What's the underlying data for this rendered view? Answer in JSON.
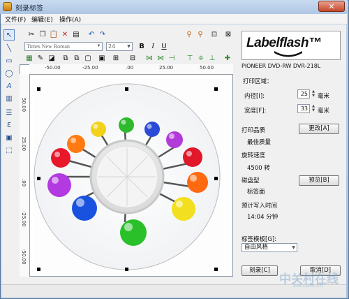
{
  "window": {
    "title": "刻录标签",
    "close_glyph": "✕"
  },
  "menu": {
    "file": "文件(F)",
    "edit": "编辑(E)",
    "operate": "操作(A)"
  },
  "toolbar": {
    "font_name": "Times New Roman",
    "font_size": "24",
    "bold": "B",
    "italic": "I",
    "underline": "U"
  },
  "ruler": {
    "h_ticks": [
      "-50.00",
      "-25.00",
      ".00",
      "25.00",
      "50.00"
    ],
    "v_ticks": [
      "50.00",
      "25.00",
      ".00",
      "-25.00",
      "-50.00"
    ]
  },
  "panel": {
    "logo_text": "Labelflash™",
    "drive_name": "PIONEER DVD-RW  DVR-218L",
    "print_area": "打印区域：",
    "inner_diameter_label": "内径[I]:",
    "inner_diameter_value": "25",
    "inner_unit": "毫米",
    "width_label": "宽度[F]:",
    "width_value": "33",
    "width_unit": "毫米",
    "print_quality_label": "打印品质",
    "change_button": "更改[A]",
    "quality_value": "最佳质量",
    "speed_label": "旋转速度",
    "speed_value": "4500 转",
    "disc_type_label": "磁盘型",
    "preview_button": "预览[B]",
    "disc_type_value": "标签面",
    "estimated_time_label": "预计写入时间",
    "estimated_time_value": "14:04 分钟",
    "template_label": "标签模板[G]:",
    "template_value": "自由风格",
    "burn_button": "刻录[C]",
    "cancel_button": "取消[D]"
  },
  "watermark": {
    "text": "中关村在线",
    "sub": "zol.com.cn"
  }
}
